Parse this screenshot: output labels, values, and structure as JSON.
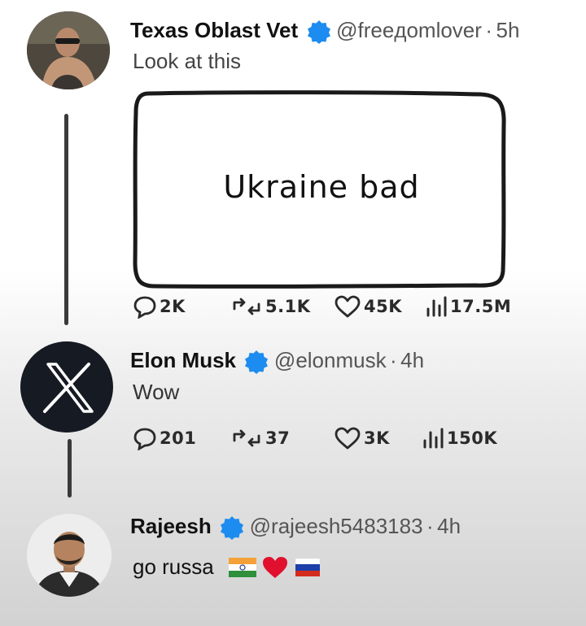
{
  "posts": [
    {
      "author": "Texas Oblast Vet",
      "handle": "@freeдomlover",
      "time": "5h",
      "text": "Look at this",
      "image_text": "Ukraine bad",
      "stats": {
        "replies": "2K",
        "reposts": "5.1K",
        "likes": "45K",
        "views": "17.5M"
      }
    },
    {
      "author": "Elon Musk",
      "handle": "@elonmusk",
      "time": "4h",
      "text": "Wow",
      "stats": {
        "replies": "201",
        "reposts": "37",
        "likes": "3K",
        "views": "150K"
      }
    },
    {
      "author": "Rajeesh",
      "handle": "@rajeesh5483183",
      "time": "4h",
      "text": "go russa"
    }
  ],
  "colors": {
    "verified": "#1d8cf0",
    "heart": "#e0102e"
  },
  "icons": [
    "reply-icon",
    "repost-icon",
    "like-icon",
    "views-icon",
    "verified-badge-icon",
    "x-logo-icon",
    "india-flag-icon",
    "heart-icon",
    "russia-flag-icon"
  ]
}
